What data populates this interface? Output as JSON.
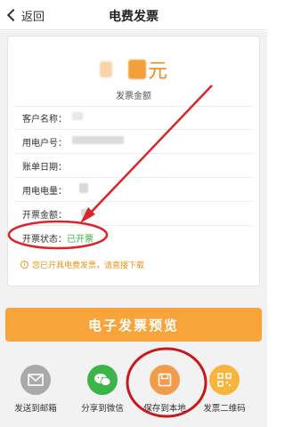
{
  "header": {
    "back_label": "返回",
    "title": "电费发票"
  },
  "invoice": {
    "amount_unit": "元",
    "amount_caption": "发票金额",
    "rows": [
      {
        "label": "客户名称：",
        "value": ""
      },
      {
        "label": "用电户号：",
        "value": ""
      },
      {
        "label": "账单日期：",
        "value": ""
      },
      {
        "label": "用电电量：",
        "value": ""
      },
      {
        "label": "开票金额：",
        "value": ""
      }
    ],
    "status": {
      "label": "开票状态：",
      "value": "已开票"
    },
    "notice": "您已开具电费发票，请直接下载",
    "notice_icon": "info-icon"
  },
  "preview_button": "电子发票预览",
  "actions": [
    {
      "label": "发送到邮箱",
      "icon": "mail-icon",
      "color": "#a9a9a9"
    },
    {
      "label": "分享到微信",
      "icon": "wechat-icon",
      "color": "#3bb54a"
    },
    {
      "label": "保存到本地",
      "icon": "save-icon",
      "color": "#f29b4b"
    },
    {
      "label": "发票二维码",
      "icon": "qrcode-icon",
      "color": "#f7b53b"
    }
  ],
  "colors": {
    "accent": "#f7a43a",
    "status_green": "#39b34a",
    "annotation_red": "#d9262b"
  }
}
